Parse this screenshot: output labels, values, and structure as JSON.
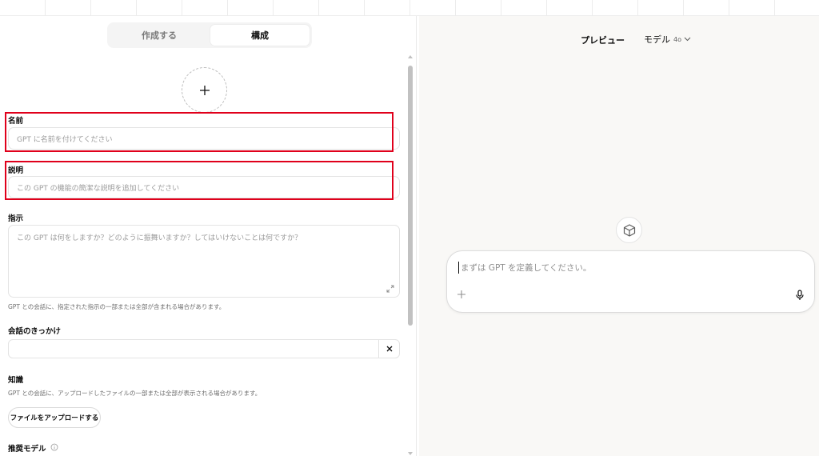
{
  "tabs": {
    "create": "作成する",
    "configure": "構成"
  },
  "name_field": {
    "label": "名前",
    "placeholder": "GPT に名前を付けてください"
  },
  "description_field": {
    "label": "説明",
    "placeholder": "この GPT の機能の簡潔な説明を追加してください"
  },
  "instructions_field": {
    "label": "指示",
    "placeholder": "この GPT は何をしますか？どのように振舞いますか？してはいけないことは何ですか？",
    "hint": "GPT との会話に、指定された指示の一部または全部が含まれる場合があります。"
  },
  "conversation_starters": {
    "label": "会話のきっかけ",
    "value": ""
  },
  "knowledge": {
    "label": "知識",
    "hint": "GPT との会話に、アップロードしたファイルの一部または全部が表示される場合があります。",
    "upload_button": "ファイルをアップロードする"
  },
  "recommended_model": {
    "label": "推奨モデル"
  },
  "preview": {
    "title": "プレビュー",
    "model_label": "モデル",
    "model_value": "4o",
    "composer_placeholder": "まずは GPT を定義してください。"
  },
  "colors": {
    "highlight": "#e0001b",
    "preview_bg": "#f9f8f6"
  },
  "icons": [
    "plus-icon",
    "expand-icon",
    "close-icon",
    "info-icon",
    "chevron-down-icon",
    "cube-icon",
    "microphone-icon"
  ]
}
